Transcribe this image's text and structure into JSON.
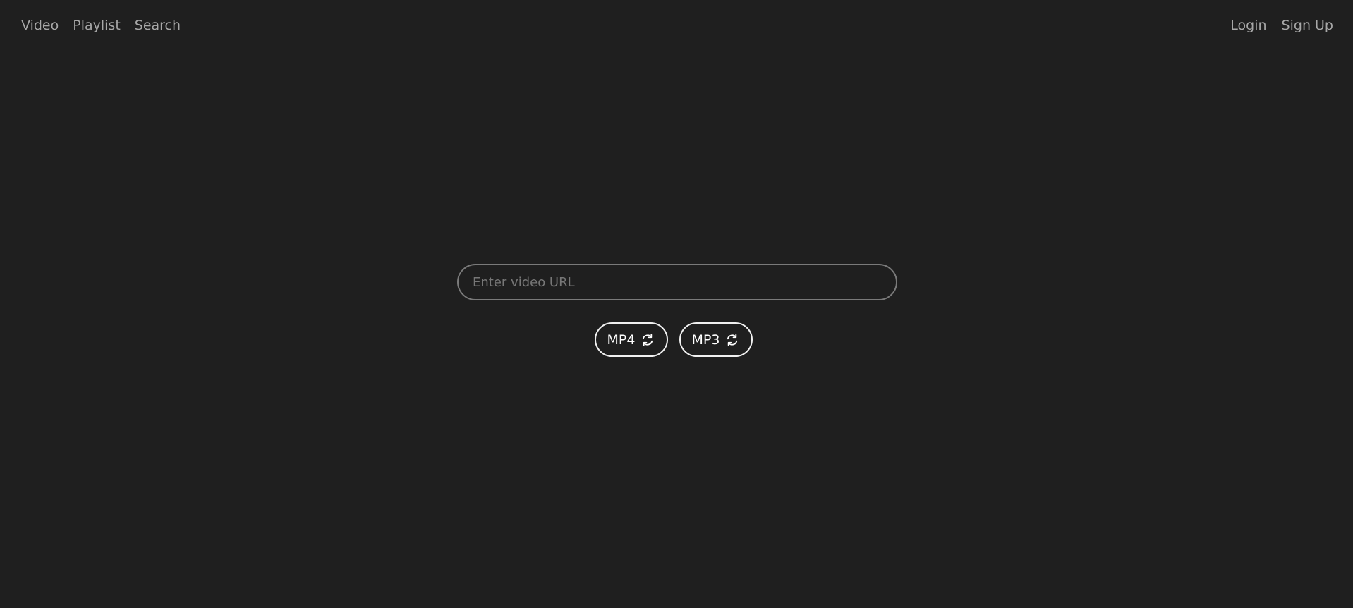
{
  "nav": {
    "left": [
      "Video",
      "Playlist",
      "Search"
    ],
    "right": [
      "Login",
      "Sign Up"
    ]
  },
  "url_input": {
    "placeholder": "Enter video URL",
    "value": ""
  },
  "buttons": [
    {
      "label": "MP4",
      "icon": "refresh-icon"
    },
    {
      "label": "MP3",
      "icon": "refresh-icon"
    }
  ],
  "colors": {
    "background": "#1f1f1f",
    "nav_text": "#a8a8a8",
    "input_border": "#7a7a7a",
    "button_border": "#f0f0f0"
  }
}
